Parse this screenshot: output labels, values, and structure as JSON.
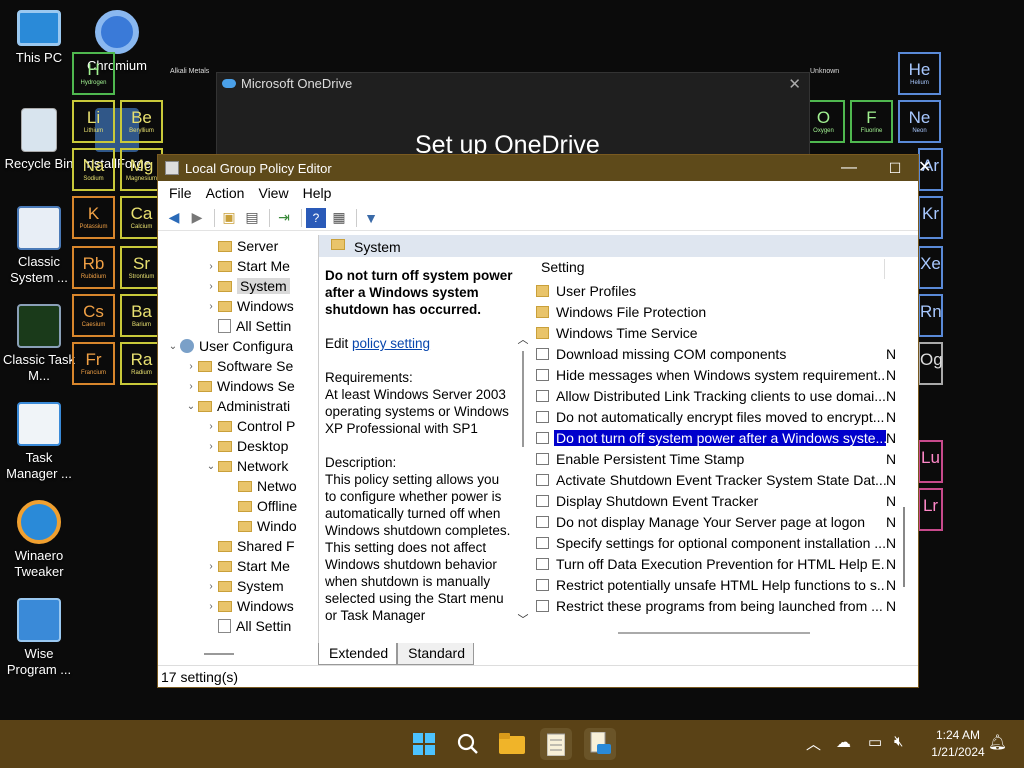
{
  "desktop": {
    "icons": [
      {
        "label": "This PC"
      },
      {
        "label": "Chromium"
      },
      {
        "label": "Recycle Bin"
      },
      {
        "label": "InstallForge"
      },
      {
        "label": "Classic System ..."
      },
      {
        "label": "Classic Task M..."
      },
      {
        "label": "Task Manager ..."
      },
      {
        "label": "Winaero Tweaker"
      },
      {
        "label": "Wise Program ..."
      }
    ],
    "periodic_table": {
      "labels": [
        "Alkali Metals",
        "Unknown"
      ],
      "elements": [
        {
          "sym": "H",
          "name": "Hydrogen"
        },
        {
          "sym": "Li",
          "name": "Lithium"
        },
        {
          "sym": "Be",
          "name": "Beryllium"
        },
        {
          "sym": "Na",
          "name": "Sodium"
        },
        {
          "sym": "Mg",
          "name": "Magnesium"
        },
        {
          "sym": "K",
          "name": "Potassium"
        },
        {
          "sym": "Ca",
          "name": "Calcium"
        },
        {
          "sym": "Rb",
          "name": "Rubidium"
        },
        {
          "sym": "Sr",
          "name": "Strontium"
        },
        {
          "sym": "Cs",
          "name": "Caesium"
        },
        {
          "sym": "Ba",
          "name": "Barium"
        },
        {
          "sym": "Fr",
          "name": "Francium"
        },
        {
          "sym": "Ra",
          "name": "Radium"
        },
        {
          "sym": "He",
          "name": "Helium"
        },
        {
          "sym": "Ne",
          "name": "Neon"
        },
        {
          "sym": "O",
          "name": "Oxygen"
        },
        {
          "sym": "F",
          "name": "Fluorine"
        },
        {
          "sym": "Ar",
          "name": ""
        },
        {
          "sym": "Kr",
          "name": ""
        },
        {
          "sym": "Xe",
          "name": ""
        },
        {
          "sym": "Rn",
          "name": ""
        },
        {
          "sym": "Og",
          "name": ""
        },
        {
          "sym": "Lu",
          "name": ""
        },
        {
          "sym": "Lr",
          "name": ""
        }
      ]
    }
  },
  "onedrive": {
    "title": "Microsoft OneDrive",
    "heading": "Set up OneDrive",
    "close": "✕"
  },
  "window": {
    "title": "Local Group Policy Editor",
    "minimize": "—",
    "maximize": "☐",
    "close": "✕",
    "menu": [
      "File",
      "Action",
      "View",
      "Help"
    ]
  },
  "tree": {
    "nodes": [
      {
        "label": "Server"
      },
      {
        "label": "Start Me"
      },
      {
        "label": "System"
      },
      {
        "label": "Windows"
      },
      {
        "label": "All Settin"
      },
      {
        "label": "User Configura"
      },
      {
        "label": "Software Se"
      },
      {
        "label": "Windows Se"
      },
      {
        "label": "Administrati"
      },
      {
        "label": "Control P"
      },
      {
        "label": "Desktop"
      },
      {
        "label": "Network"
      },
      {
        "label": "Netwo"
      },
      {
        "label": "Offline"
      },
      {
        "label": "Windo"
      },
      {
        "label": "Shared F"
      },
      {
        "label": "Start Me"
      },
      {
        "label": "System"
      },
      {
        "label": "Windows"
      },
      {
        "label": "All Settin"
      }
    ]
  },
  "details": {
    "header": "System",
    "title": "Do not turn off system power after a Windows system shutdown has occurred.",
    "edit_prefix": "Edit ",
    "edit_link": "policy setting",
    "requirements_label": "Requirements:",
    "requirements": "At least Windows Server 2003 operating systems or Windows XP Professional with SP1",
    "description_label": "Description:",
    "description": "This policy setting allows you to configure whether power is automatically turned off when Windows shutdown completes.  This setting does not affect Windows shutdown behavior when shutdown is manually selected using the Start menu or Task Manager"
  },
  "list": {
    "column_setting": "Setting",
    "rows": [
      {
        "name": "User Profiles",
        "state": ""
      },
      {
        "name": "Windows File Protection",
        "state": ""
      },
      {
        "name": "Windows Time Service",
        "state": ""
      },
      {
        "name": "Download missing COM components",
        "state": "N"
      },
      {
        "name": "Hide messages when Windows system requirement...",
        "state": "N"
      },
      {
        "name": "Allow Distributed Link Tracking clients to use domai...",
        "state": "N"
      },
      {
        "name": "Do not automatically encrypt files moved to encrypt...",
        "state": "N"
      },
      {
        "name": "Do not turn off system power after a Windows syste...",
        "state": "N"
      },
      {
        "name": "Enable Persistent Time Stamp",
        "state": "N"
      },
      {
        "name": "Activate Shutdown Event Tracker System State Dat...",
        "state": "N"
      },
      {
        "name": "Display Shutdown Event Tracker",
        "state": "N"
      },
      {
        "name": "Do not display Manage Your Server page at logon",
        "state": "N"
      },
      {
        "name": "Specify settings for optional component installation ...",
        "state": "N"
      },
      {
        "name": "Turn off Data Execution Prevention for HTML Help E...",
        "state": "N"
      },
      {
        "name": "Restrict potentially unsafe HTML Help functions to s...",
        "state": "N"
      },
      {
        "name": "Restrict these programs from being launched from ...",
        "state": "N"
      }
    ]
  },
  "tabs": [
    "Extended",
    "Standard"
  ],
  "status": "17 setting(s)",
  "taskbar": {
    "time": "1:24 AM",
    "date": "1/21/2024"
  }
}
